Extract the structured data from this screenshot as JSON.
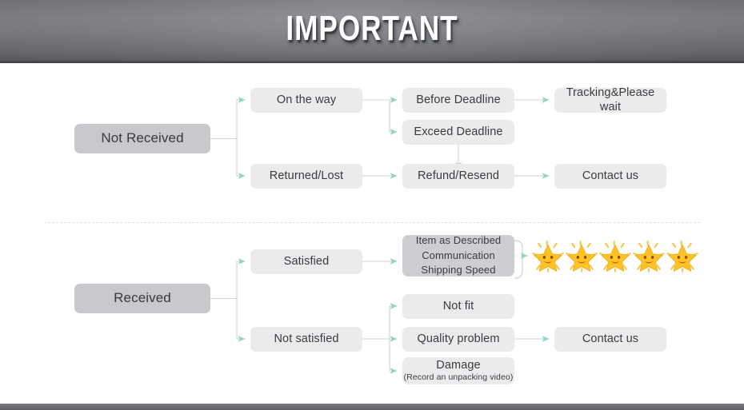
{
  "header": {
    "title": "IMPORTANT"
  },
  "colors": {
    "banner_top": "#7a7c81",
    "banner_bottom": "#55575c",
    "node_light": "#edeaee",
    "node_dark": "#c9c8cc",
    "node_multi": "#cfcdd1",
    "connector": "#9ad9c4",
    "connector_line": "#cfcfd4",
    "divider": "#cfe6f2",
    "text": "#3b3b3d",
    "star_body": "#ffc72c",
    "star_edge": "#f5a623"
  },
  "flow": {
    "not_received": {
      "root": {
        "label": "Not Received"
      },
      "branch_a": {
        "label": "On the way"
      },
      "branch_a_children": [
        {
          "label": "Before Deadline"
        },
        {
          "label": "Exceed Deadline"
        }
      ],
      "before_deadline_result": {
        "label": "Tracking&Please wait"
      },
      "branch_b": {
        "label": "Returned/Lost"
      },
      "refund": {
        "label": "Refund/Resend"
      },
      "refund_result": {
        "label": "Contact us"
      }
    },
    "received": {
      "root": {
        "label": "Received"
      },
      "branch_a": {
        "label": "Satisfied"
      },
      "criteria": {
        "line1": "Item as Described",
        "line2": "Communication",
        "line3": "Shipping Speed"
      },
      "rating": {
        "count": 5,
        "icon": "glowing-star"
      },
      "branch_b": {
        "label": "Not satisfied"
      },
      "issues": [
        {
          "label": "Not fit",
          "note": ""
        },
        {
          "label": "Quality problem",
          "note": ""
        },
        {
          "label": "Damage",
          "note": "(Record an unpacking video)"
        }
      ],
      "issue_result": {
        "label": "Contact us"
      }
    }
  }
}
